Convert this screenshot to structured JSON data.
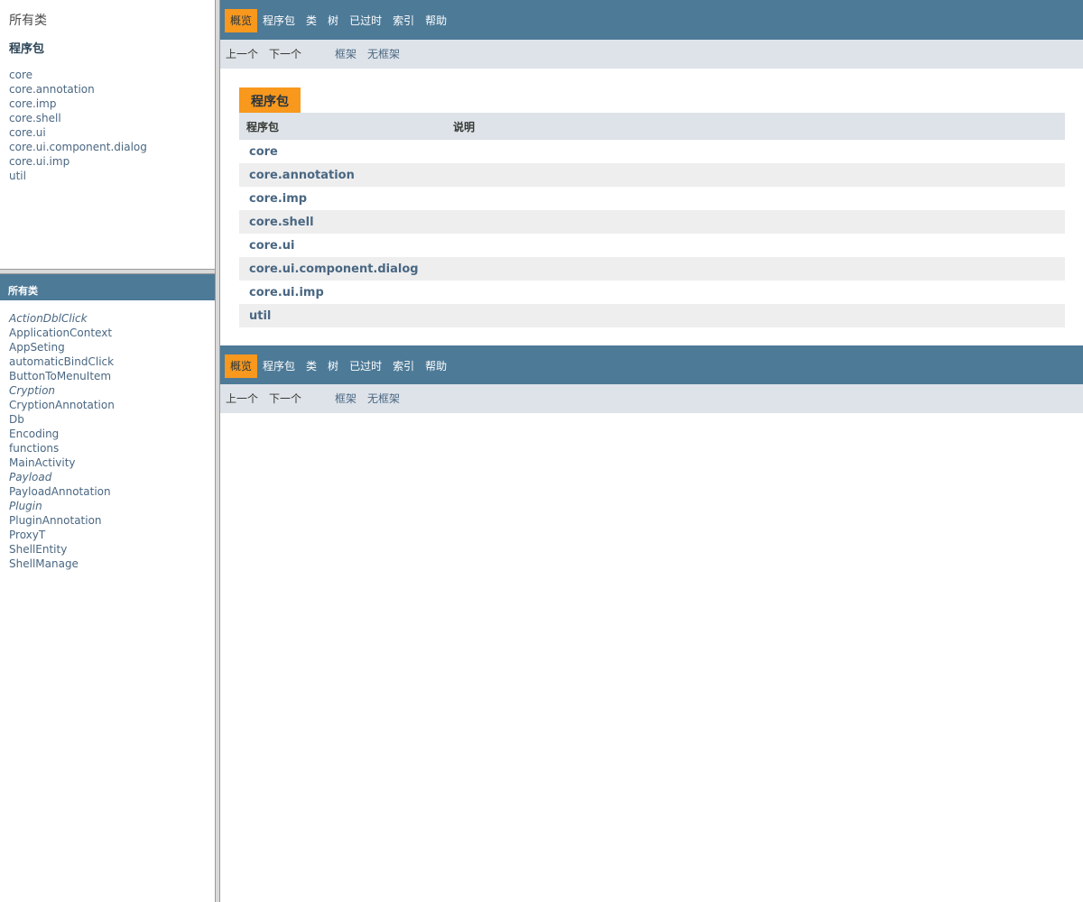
{
  "left_top": {
    "all_classes_link": "所有类",
    "packages_heading": "程序包",
    "packages": [
      "core",
      "core.annotation",
      "core.imp",
      "core.shell",
      "core.ui",
      "core.ui.component.dialog",
      "core.ui.imp",
      "util"
    ]
  },
  "left_bottom": {
    "bar_title": "所有类",
    "classes": [
      {
        "name": "ActionDblClick",
        "italic": true
      },
      {
        "name": "ApplicationContext",
        "italic": false
      },
      {
        "name": "AppSeting",
        "italic": false
      },
      {
        "name": "automaticBindClick",
        "italic": false
      },
      {
        "name": "ButtonToMenuItem",
        "italic": false
      },
      {
        "name": "Cryption",
        "italic": true
      },
      {
        "name": "CryptionAnnotation",
        "italic": false
      },
      {
        "name": "Db",
        "italic": false
      },
      {
        "name": "Encoding",
        "italic": false
      },
      {
        "name": "functions",
        "italic": false
      },
      {
        "name": "MainActivity",
        "italic": false
      },
      {
        "name": "Payload",
        "italic": true
      },
      {
        "name": "PayloadAnnotation",
        "italic": false
      },
      {
        "name": "Plugin",
        "italic": true
      },
      {
        "name": "PluginAnnotation",
        "italic": false
      },
      {
        "name": "ProxyT",
        "italic": false
      },
      {
        "name": "ShellEntity",
        "italic": false
      },
      {
        "name": "ShellManage",
        "italic": false
      }
    ]
  },
  "nav": {
    "items": [
      "概览",
      "程序包",
      "类",
      "树",
      "已过时",
      "索引",
      "帮助"
    ],
    "active_index": 0,
    "prev": "上一个",
    "next": "下一个",
    "frames": "框架",
    "no_frames": "无框架"
  },
  "summary": {
    "caption": "程序包",
    "col_package": "程序包",
    "col_description": "说明",
    "rows": [
      "core",
      "core.annotation",
      "core.imp",
      "core.shell",
      "core.ui",
      "core.ui.component.dialog",
      "core.ui.imp",
      "util"
    ]
  },
  "colors": {
    "nav_bg": "#4d7a97",
    "active_tab": "#f8981d",
    "subnav_bg": "#dee3e9",
    "link": "#4a6782"
  }
}
